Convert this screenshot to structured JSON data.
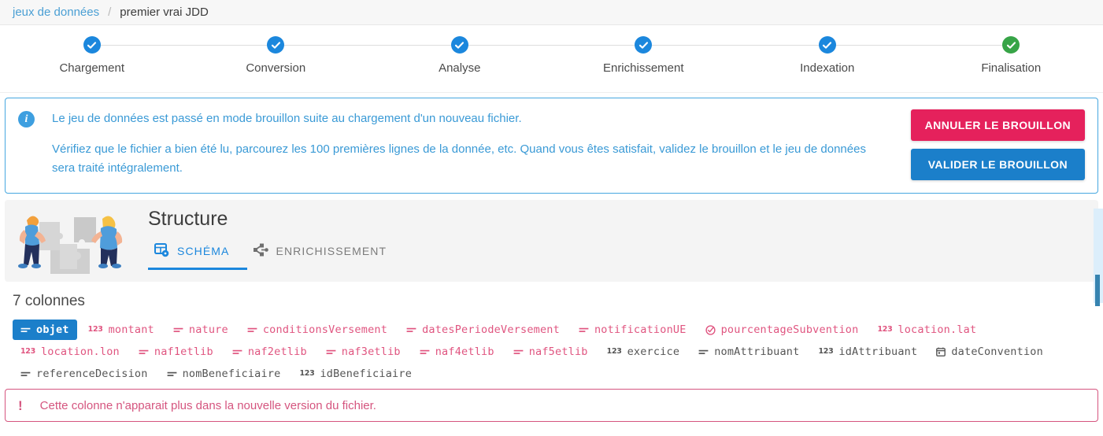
{
  "breadcrumb": {
    "root": "jeux de données",
    "separator": "/",
    "current": "premier vrai JDD"
  },
  "stepper": {
    "steps": [
      {
        "label": "Chargement",
        "state": "done"
      },
      {
        "label": "Conversion",
        "state": "done"
      },
      {
        "label": "Analyse",
        "state": "done"
      },
      {
        "label": "Enrichissement",
        "state": "done"
      },
      {
        "label": "Indexation",
        "state": "done"
      },
      {
        "label": "Finalisation",
        "state": "complete"
      }
    ],
    "done_color": "#1b87dd",
    "complete_color": "#37a447"
  },
  "banner": {
    "icon": "info-icon",
    "line1": "Le jeu de données est passé en mode brouillon suite au chargement d'un nouveau fichier.",
    "line2": "Vérifiez que le fichier a bien été lu, parcourez les 100 premières lignes de la donnée, etc. Quand vous êtes satisfait, validez le brouillon et le jeu de données sera traité intégralement.",
    "cancel_label": "ANNULER LE BROUILLON",
    "validate_label": "VALIDER LE BROUILLON",
    "cancel_color": "#e5215c",
    "validate_color": "#1b7fca",
    "border_color": "#46a7e0",
    "text_color": "#3a9ad6"
  },
  "structure": {
    "title": "Structure",
    "illustration": "people-puzzle-illustration",
    "tabs": [
      {
        "label": "SCHÉMA",
        "icon": "grid-settings-icon",
        "active": true
      },
      {
        "label": "ENRICHISSEMENT",
        "icon": "branch-nodes-icon",
        "active": false
      }
    ]
  },
  "columns": {
    "count_label": "7 colonnes",
    "items": [
      {
        "name": "objet",
        "type": "text",
        "state": "selected"
      },
      {
        "name": "montant",
        "type": "number",
        "state": "missing"
      },
      {
        "name": "nature",
        "type": "text",
        "state": "missing"
      },
      {
        "name": "conditionsVersement",
        "type": "text",
        "state": "missing"
      },
      {
        "name": "datesPeriodeVersement",
        "type": "text",
        "state": "missing"
      },
      {
        "name": "notificationUE",
        "type": "text",
        "state": "missing"
      },
      {
        "name": "pourcentageSubvention",
        "type": "boolean",
        "state": "missing"
      },
      {
        "name": "location.lat",
        "type": "number",
        "state": "missing"
      },
      {
        "name": "location.lon",
        "type": "number",
        "state": "missing"
      },
      {
        "name": "naf1etlib",
        "type": "text",
        "state": "missing"
      },
      {
        "name": "naf2etlib",
        "type": "text",
        "state": "missing"
      },
      {
        "name": "naf3etlib",
        "type": "text",
        "state": "missing"
      },
      {
        "name": "naf4etlib",
        "type": "text",
        "state": "missing"
      },
      {
        "name": "naf5etlib",
        "type": "text",
        "state": "missing"
      },
      {
        "name": "exercice",
        "type": "number",
        "state": "normal"
      },
      {
        "name": "nomAttribuant",
        "type": "text",
        "state": "normal"
      },
      {
        "name": "idAttribuant",
        "type": "number",
        "state": "normal"
      },
      {
        "name": "dateConvention",
        "type": "date",
        "state": "normal"
      },
      {
        "name": "referenceDecision",
        "type": "text",
        "state": "normal"
      },
      {
        "name": "nomBeneficiaire",
        "type": "text",
        "state": "normal"
      },
      {
        "name": "idBeneficiaire",
        "type": "number",
        "state": "normal"
      }
    ],
    "missing_color": "#e05580",
    "selected_color": "#1b7fca"
  },
  "error": {
    "mark": "!",
    "message": "Cette colonne n'apparait plus dans la nouvelle version du fichier.",
    "color": "#d5557f"
  }
}
